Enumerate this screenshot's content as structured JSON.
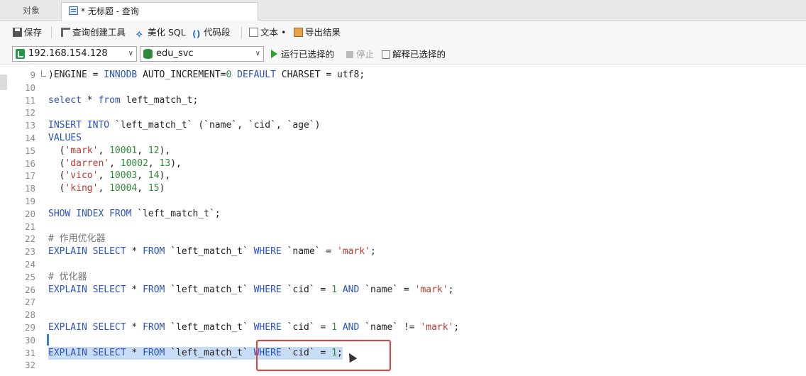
{
  "tabs": {
    "objects": "对象",
    "query": "* 无标题 - 查询"
  },
  "toolbar": {
    "save": "保存",
    "query_builder": "查询创建工具",
    "beautify": "美化 SQL",
    "snippet": "代码段",
    "text": "文本 •",
    "export": "导出结果"
  },
  "connection": {
    "host": "192.168.154.128",
    "database": "edu_svc",
    "run_selected": "运行已选择的",
    "stop": "停止",
    "explain_selected": "解释已选择的"
  },
  "editor": {
    "lines": [
      {
        "n": "9",
        "tokens": [
          [
            "id",
            ")ENGINE = "
          ],
          [
            "kw",
            "INNODB"
          ],
          [
            "id",
            " AUTO_INCREMENT="
          ],
          [
            "num",
            "0"
          ],
          [
            "id",
            " "
          ],
          [
            "kw",
            "DEFAULT"
          ],
          [
            "id",
            " CHARSET = utf8;"
          ]
        ]
      },
      {
        "n": "10",
        "tokens": []
      },
      {
        "n": "11",
        "tokens": [
          [
            "kw",
            "select"
          ],
          [
            "id",
            " * "
          ],
          [
            "kw",
            "from"
          ],
          [
            "id",
            " left_match_t;"
          ]
        ]
      },
      {
        "n": "12",
        "tokens": []
      },
      {
        "n": "13",
        "tokens": [
          [
            "kw",
            "INSERT INTO"
          ],
          [
            "id",
            " `left_match_t` (`name`, `cid`, `age`)"
          ]
        ]
      },
      {
        "n": "14",
        "tokens": [
          [
            "kw",
            "VALUES"
          ]
        ]
      },
      {
        "n": "15",
        "tokens": [
          [
            "id",
            "  ("
          ],
          [
            "str",
            "'mark'"
          ],
          [
            "id",
            ", "
          ],
          [
            "num",
            "10001"
          ],
          [
            "id",
            ", "
          ],
          [
            "num",
            "12"
          ],
          [
            "id",
            "),"
          ]
        ]
      },
      {
        "n": "16",
        "tokens": [
          [
            "id",
            "  ("
          ],
          [
            "str",
            "'darren'"
          ],
          [
            "id",
            ", "
          ],
          [
            "num",
            "10002"
          ],
          [
            "id",
            ", "
          ],
          [
            "num",
            "13"
          ],
          [
            "id",
            "),"
          ]
        ]
      },
      {
        "n": "17",
        "tokens": [
          [
            "id",
            "  ("
          ],
          [
            "str",
            "'vico'"
          ],
          [
            "id",
            ", "
          ],
          [
            "num",
            "10003"
          ],
          [
            "id",
            ", "
          ],
          [
            "num",
            "14"
          ],
          [
            "id",
            "),"
          ]
        ]
      },
      {
        "n": "18",
        "tokens": [
          [
            "id",
            "  ("
          ],
          [
            "str",
            "'king'"
          ],
          [
            "id",
            ", "
          ],
          [
            "num",
            "10004"
          ],
          [
            "id",
            ", "
          ],
          [
            "num",
            "15"
          ],
          [
            "id",
            ")"
          ]
        ]
      },
      {
        "n": "19",
        "tokens": []
      },
      {
        "n": "20",
        "tokens": [
          [
            "kw",
            "SHOW INDEX FROM"
          ],
          [
            "id",
            " `left_match_t`;"
          ]
        ]
      },
      {
        "n": "21",
        "tokens": []
      },
      {
        "n": "22",
        "tokens": [
          [
            "cm",
            "# 作用优化器"
          ]
        ]
      },
      {
        "n": "23",
        "tokens": [
          [
            "kw",
            "EXPLAIN SELECT"
          ],
          [
            "id",
            " * "
          ],
          [
            "kw",
            "FROM"
          ],
          [
            "id",
            " `left_match_t` "
          ],
          [
            "kw",
            "WHERE"
          ],
          [
            "id",
            " `name` = "
          ],
          [
            "str",
            "'mark'"
          ],
          [
            "id",
            ";"
          ]
        ]
      },
      {
        "n": "24",
        "tokens": []
      },
      {
        "n": "25",
        "tokens": [
          [
            "cm",
            "# 优化器"
          ]
        ]
      },
      {
        "n": "26",
        "tokens": [
          [
            "kw",
            "EXPLAIN SELECT"
          ],
          [
            "id",
            " * "
          ],
          [
            "kw",
            "FROM"
          ],
          [
            "id",
            " `left_match_t` "
          ],
          [
            "kw",
            "WHERE"
          ],
          [
            "id",
            " `cid` = "
          ],
          [
            "num",
            "1"
          ],
          [
            "id",
            " "
          ],
          [
            "kw",
            "AND"
          ],
          [
            "id",
            " `name` = "
          ],
          [
            "str",
            "'mark'"
          ],
          [
            "id",
            ";"
          ]
        ]
      },
      {
        "n": "27",
        "tokens": []
      },
      {
        "n": "28",
        "tokens": []
      },
      {
        "n": "29",
        "tokens": [
          [
            "kw",
            "EXPLAIN SELECT"
          ],
          [
            "id",
            " * "
          ],
          [
            "kw",
            "FROM"
          ],
          [
            "id",
            " `left_match_t` "
          ],
          [
            "kw",
            "WHERE"
          ],
          [
            "id",
            " `cid` = "
          ],
          [
            "num",
            "1"
          ],
          [
            "id",
            " "
          ],
          [
            "kw",
            "AND"
          ],
          [
            "id",
            " `name` != "
          ],
          [
            "str",
            "'mark'"
          ],
          [
            "id",
            ";"
          ]
        ]
      },
      {
        "n": "30",
        "tokens": []
      },
      {
        "n": "31",
        "tokens": [
          [
            "kw",
            "EXPLAIN SELECT"
          ],
          [
            "id",
            " * "
          ],
          [
            "kw",
            "FROM"
          ],
          [
            "id",
            " `left_match_t` "
          ],
          [
            "kw",
            "WHERE"
          ],
          [
            "id",
            " `cid` = "
          ],
          [
            "num",
            "1"
          ],
          [
            "id",
            ";"
          ]
        ]
      },
      {
        "n": "32",
        "tokens": []
      }
    ],
    "selected_line": "31"
  },
  "colors": {
    "keyword": "#2a52be",
    "string": "#c0392b",
    "number": "#2e8b3a",
    "selection": "#c9dcf5",
    "annotation_box": "#e4403a"
  }
}
